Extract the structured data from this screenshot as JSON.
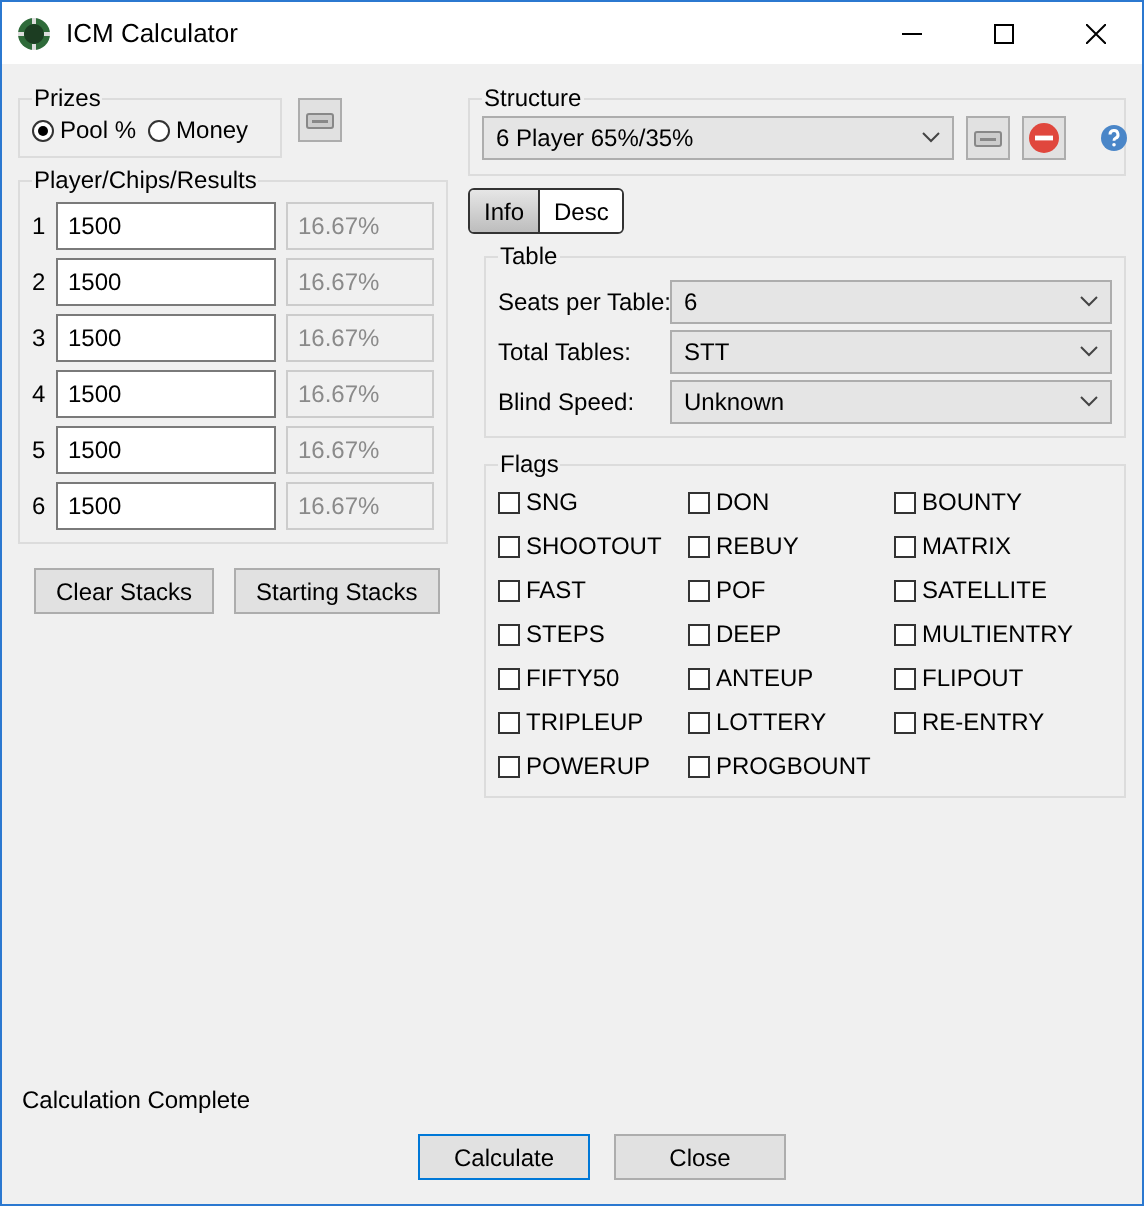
{
  "window": {
    "title": "ICM Calculator"
  },
  "prizes": {
    "title": "Prizes",
    "options": [
      {
        "label": "Pool %",
        "selected": true
      },
      {
        "label": "Money",
        "selected": false
      }
    ]
  },
  "players": {
    "title": "Player/Chips/Results",
    "rows": [
      {
        "number": "1",
        "chips": "1500",
        "result": "16.67%"
      },
      {
        "number": "2",
        "chips": "1500",
        "result": "16.67%"
      },
      {
        "number": "3",
        "chips": "1500",
        "result": "16.67%"
      },
      {
        "number": "4",
        "chips": "1500",
        "result": "16.67%"
      },
      {
        "number": "5",
        "chips": "1500",
        "result": "16.67%"
      },
      {
        "number": "6",
        "chips": "1500",
        "result": "16.67%"
      }
    ]
  },
  "stack_buttons": [
    "Clear Stacks",
    "Starting Stacks"
  ],
  "structure": {
    "title": "Structure",
    "value": "6 Player 65%/35%"
  },
  "tabs": [
    {
      "label": "Info",
      "selected": true
    },
    {
      "label": "Desc",
      "selected": false
    }
  ],
  "table": {
    "title": "Table",
    "fields": [
      {
        "label": "Seats per Table:",
        "value": "6"
      },
      {
        "label": "Total Tables:",
        "value": "STT"
      },
      {
        "label": "Blind Speed:",
        "value": "Unknown"
      }
    ]
  },
  "flags": {
    "title": "Flags",
    "items": [
      {
        "label": "SNG",
        "checked": false
      },
      {
        "label": "DON",
        "checked": false
      },
      {
        "label": "BOUNTY",
        "checked": false
      },
      {
        "label": "SHOOTOUT",
        "checked": false
      },
      {
        "label": "REBUY",
        "checked": false
      },
      {
        "label": "MATRIX",
        "checked": false
      },
      {
        "label": "FAST",
        "checked": false
      },
      {
        "label": "POF",
        "checked": false
      },
      {
        "label": "SATELLITE",
        "checked": false
      },
      {
        "label": "STEPS",
        "checked": false
      },
      {
        "label": "DEEP",
        "checked": false
      },
      {
        "label": "MULTIENTRY",
        "checked": false
      },
      {
        "label": "FIFTY50",
        "checked": false
      },
      {
        "label": "ANTEUP",
        "checked": false
      },
      {
        "label": "FLIPOUT",
        "checked": false
      },
      {
        "label": "TRIPLEUP",
        "checked": false
      },
      {
        "label": "LOTTERY",
        "checked": false
      },
      {
        "label": "RE-ENTRY",
        "checked": false
      },
      {
        "label": "POWERUP",
        "checked": false
      },
      {
        "label": "PROGBOUNT",
        "checked": false
      }
    ]
  },
  "status": "Calculation Complete",
  "buttons": [
    "Calculate",
    "Close"
  ]
}
